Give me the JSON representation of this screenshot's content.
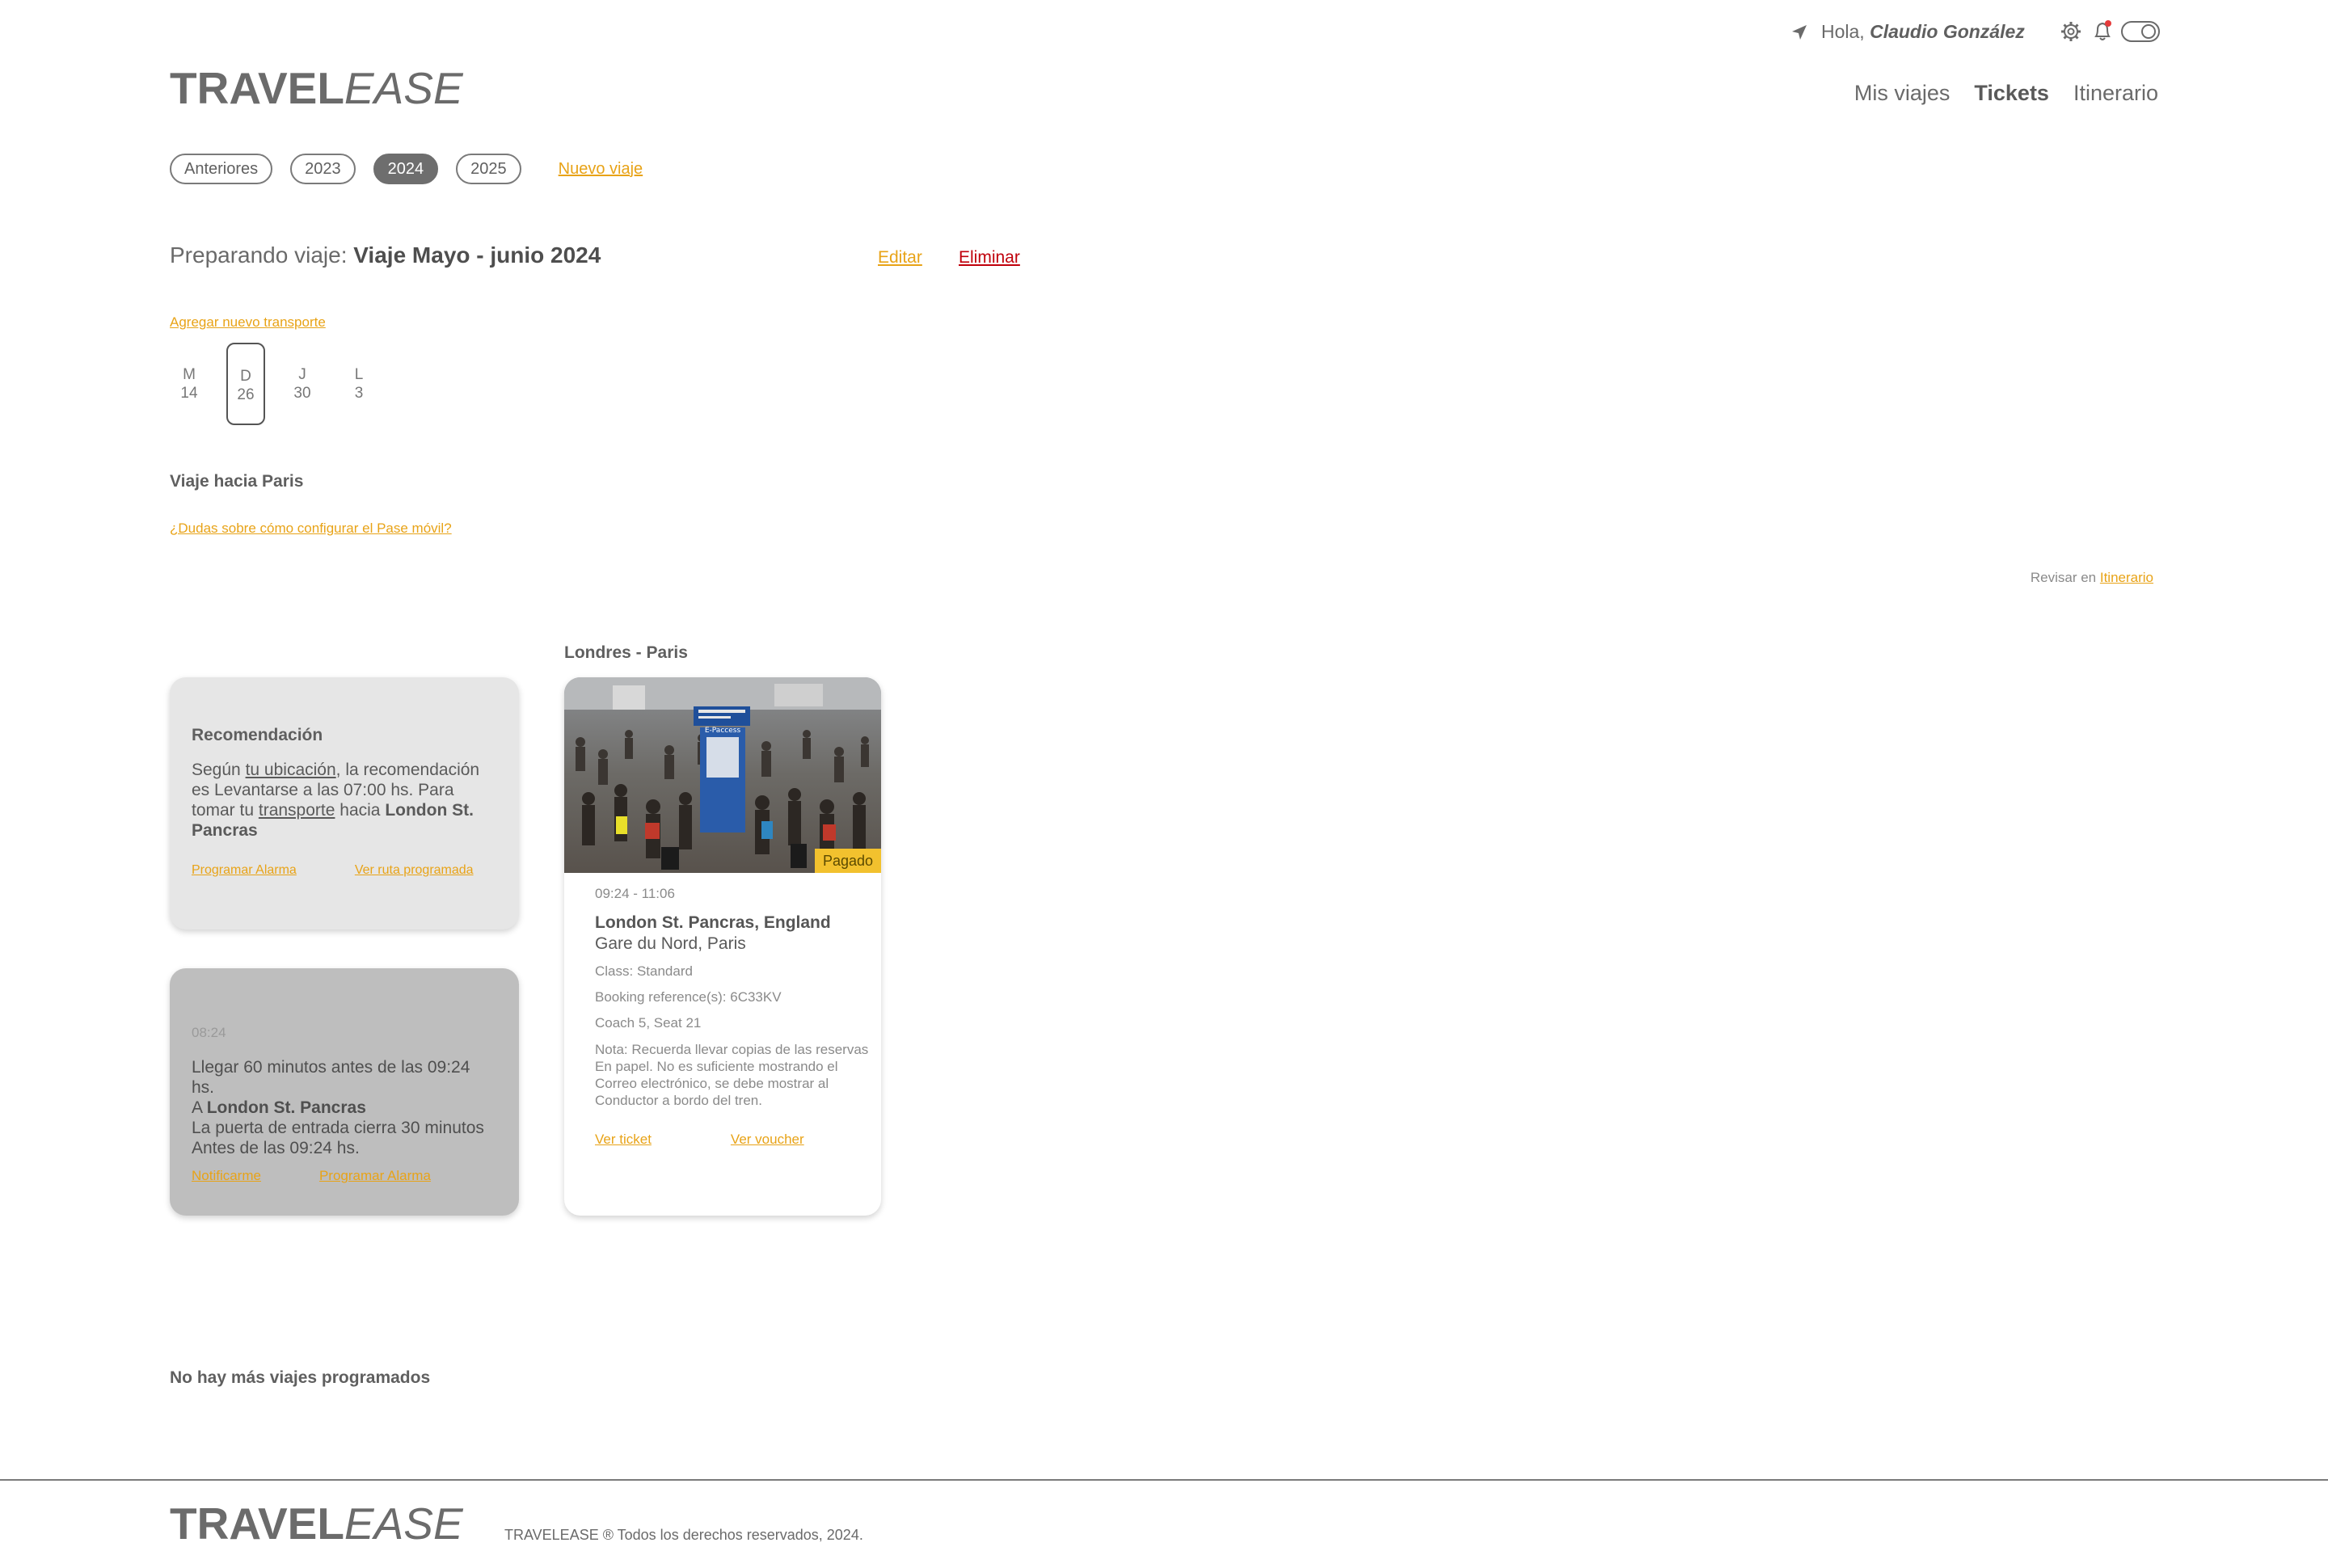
{
  "header": {
    "greeting": "Hola,",
    "user_name": "Claudio González",
    "logo_part1": "TRAVEL",
    "logo_part2": "EASE",
    "nav": [
      "Mis viajes",
      "Tickets",
      "Itinerario"
    ],
    "nav_active": "Tickets"
  },
  "years": {
    "items": [
      "Anteriores",
      "2023",
      "2024",
      "2025"
    ],
    "active": "2024",
    "new_trip": "Nuevo viaje"
  },
  "trip": {
    "prefix": "Preparando viaje:",
    "name": "Viaje Mayo - junio 2024",
    "edit": "Editar",
    "delete": "Eliminar",
    "add_transport": "Agregar nuevo transporte",
    "days": [
      {
        "dow": "M",
        "num": "14"
      },
      {
        "dow": "D",
        "num": "26"
      },
      {
        "dow": "J",
        "num": "30"
      },
      {
        "dow": "L",
        "num": "3"
      }
    ],
    "active_day": "D",
    "section_title": "Viaje hacia Paris",
    "faq": "¿Dudas sobre cómo configurar el Pase móvil?",
    "review_prefix": "Revisar en",
    "review_link": "Itinerario",
    "route_title": "Londres - Paris"
  },
  "recommendation": {
    "title": "Recomendación",
    "t1": "Según",
    "t_link1": "tu ubicación",
    "t2": ", la recomendación es Levantarse a las 07:00 hs. Para tomar tu",
    "t_link2": "transporte",
    "t3": "hacia",
    "t_bold": "London St. Pancras",
    "link1": "Programar Alarma",
    "link2": "Ver ruta programada"
  },
  "alarm": {
    "time": "08:24",
    "line1": "Llegar 60 minutos antes de las 09:24 hs.",
    "line2_prefix": "A",
    "line2_bold": "London St. Pancras",
    "line3": "La puerta de entrada cierra 30 minutos Antes de las 09:24 hs.",
    "link1": "Notificarme",
    "link2": "Programar Alarma"
  },
  "ticket": {
    "badge": "Pagado",
    "time": "09:24 - 11:06",
    "from": "London St. Pancras, England",
    "to": "Gare du Nord, Paris",
    "class": "Class: Standard",
    "booking": "Booking reference(s): 6C33KV",
    "seat": "Coach 5, Seat 21",
    "note": "Nota: Recuerda llevar copias de las reservas\nEn papel. No es suficiente mostrando el\nCorreo electrónico, se debe mostrar al\nConductor a bordo del tren.",
    "view_ticket": "Ver ticket",
    "view_voucher": "Ver voucher",
    "photo_sign": "E-Paccess"
  },
  "footer": {
    "no_more": "No hay más viajes programados",
    "copyright": "TRAVELEASE ® Todos los derechos reservados, 2024."
  },
  "colors": {
    "accent": "#E8A317",
    "danger": "#C0000B",
    "badge": "#F2C12E",
    "recommendation_bg": "#E6E6E6",
    "alarm_bg": "#BEBEBE"
  }
}
